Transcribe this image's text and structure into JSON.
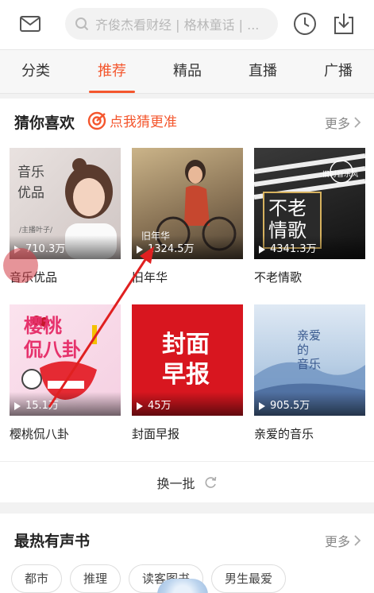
{
  "header": {
    "search_placeholder": "齐俊杰看财经 | 格林童话 | ...",
    "icons": [
      "mail-icon",
      "search-icon",
      "clock-icon",
      "download-icon"
    ]
  },
  "tabs": [
    {
      "label": "分类"
    },
    {
      "label": "推荐"
    },
    {
      "label": "精品"
    },
    {
      "label": "直播"
    },
    {
      "label": "广播"
    }
  ],
  "active_tab": "推荐",
  "guess": {
    "title": "猜你喜欢",
    "hint": "点我猜更准",
    "more": "更多",
    "items": [
      {
        "name": "音乐优品",
        "plays": "710.3万",
        "cover_text": "音乐\n优品",
        "cover_sub": "/主播叶子/"
      },
      {
        "name": "旧年华",
        "plays": "1324.5万",
        "cover_text": "旧年华"
      },
      {
        "name": "不老情歌",
        "plays": "4341.3万",
        "cover_text": "不老\n情歌",
        "cover_sub": "旧时音乐风"
      },
      {
        "name": "樱桃侃八卦",
        "plays": "15.1万",
        "cover_text": "樱桃\n侃八卦"
      },
      {
        "name": "封面早报",
        "plays": "45万",
        "cover_text": "封面\n早报"
      },
      {
        "name": "亲爱的音乐",
        "plays": "905.5万",
        "cover_text": "亲爱\n的\n音乐"
      }
    ],
    "refresh": "换一批"
  },
  "hot_books": {
    "title": "最热有声书",
    "more": "更多",
    "chips": [
      "都市",
      "推理",
      "读客图书",
      "男生最爱"
    ]
  },
  "colors": {
    "accent": "#f4562d",
    "arrow": "#e02020"
  }
}
